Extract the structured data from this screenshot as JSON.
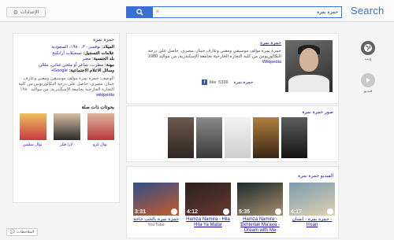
{
  "header": {
    "settings_label": "الإعدادات",
    "search_value": "حمزة نمرة",
    "logo_text": "Search"
  },
  "rail": [
    {
      "label": "ويب",
      "icon": "globe-icon"
    },
    {
      "label": "فيديو",
      "icon": "play-icon"
    }
  ],
  "knowledge_panel": {
    "title": "حمزة نمرة",
    "rows": [
      {
        "label": "الميلاد:",
        "value": "نوفمبر ٣٠، ١٩٨٠، السعودية",
        "is_link": true
      },
      {
        "label": "علامات التسجيل:",
        "value": "تسجيلات أرابكنج",
        "is_link": true
      },
      {
        "label": "بلد الجنسية:",
        "value": "مصر",
        "is_link": true
      },
      {
        "label": "مهنة:",
        "value": "مطرب، شاعر أو ملحن غنائي، ملحّن",
        "is_link": true
      },
      {
        "label": "وسائل الاعلام الاجتماعية:",
        "value": "Google+",
        "is_link": true
      }
    ],
    "description": "الوصف: حمزة نمرة مؤلف موسيقي ومغني وعازف جيتار، مصري، حاصل على درجة البكالوريوس من كلية التجارة الخارجية بجامعة الإسكندرية، من مواليد ١٩٨٠",
    "description_source": "wikipedia",
    "related_title": "بحوثات ذات صلة",
    "related": [
      {
        "name": "نوال كرو",
        "colors": [
          "#b8373b",
          "#e0b4a0"
        ]
      },
      {
        "name": "لارا فكر",
        "colors": [
          "#2a2a2a",
          "#d8c0a8"
        ]
      },
      {
        "name": "نوال سليمن",
        "colors": [
          "#c73a40",
          "#f0c060"
        ]
      }
    ]
  },
  "result1": {
    "title": "حمزة نمرة",
    "description": "حمزة نمرة مؤلف موسيقي ومغني وعازف جيتار، مصري، حاصل على درجة البكالوريوس من كلية التجارة الخارجية بجامعة الإسكندرية، من مواليد 1980",
    "source": "Wikipedia",
    "like_count": "5336",
    "like_word": "like",
    "like_label": "حمزة نمرة"
  },
  "result2": {
    "label": "صور حمزة نمرة",
    "images": [
      {
        "bg": "linear-gradient(180deg,#6b5a4c,#2d2622)"
      },
      {
        "bg": "linear-gradient(180deg,#8a8a8a,#3a3a3a)"
      },
      {
        "bg": "linear-gradient(180deg,#f2f2f2,#cfcfcf)"
      },
      {
        "bg": "linear-gradient(180deg,#b0813e,#3a2618)"
      },
      {
        "bg": "linear-gradient(180deg,#5d5d5d,#151515)"
      }
    ]
  },
  "result3": {
    "label": "الفيديو حمزة نمرة",
    "videos": [
      {
        "time": "3:31",
        "title": "حمزة نمرة بالحب حاجة",
        "source": "YouTube",
        "bg": "linear-gradient(160deg,#304f8a,#c95a2a)"
      },
      {
        "time": "4:12",
        "title": "Hamza Namira - Hila Hila Ya Matar",
        "source": "",
        "bg": "linear-gradient(160deg,#2a2020,#6a3a30)"
      },
      {
        "time": "5:35",
        "title": "Hamza Namira - Ekhterlak Ma'aya - Dream with Me",
        "source": "",
        "bg": "linear-gradient(160deg,#1b2a2a,#a89070)"
      },
      {
        "time": "4:17",
        "title": "حمزة نمرة - إنسان - Insan",
        "source": "",
        "bg": "linear-gradient(160deg,#7a9bb0,#e0d0b0)"
      }
    ]
  },
  "feedback_label": "الملاحظات"
}
